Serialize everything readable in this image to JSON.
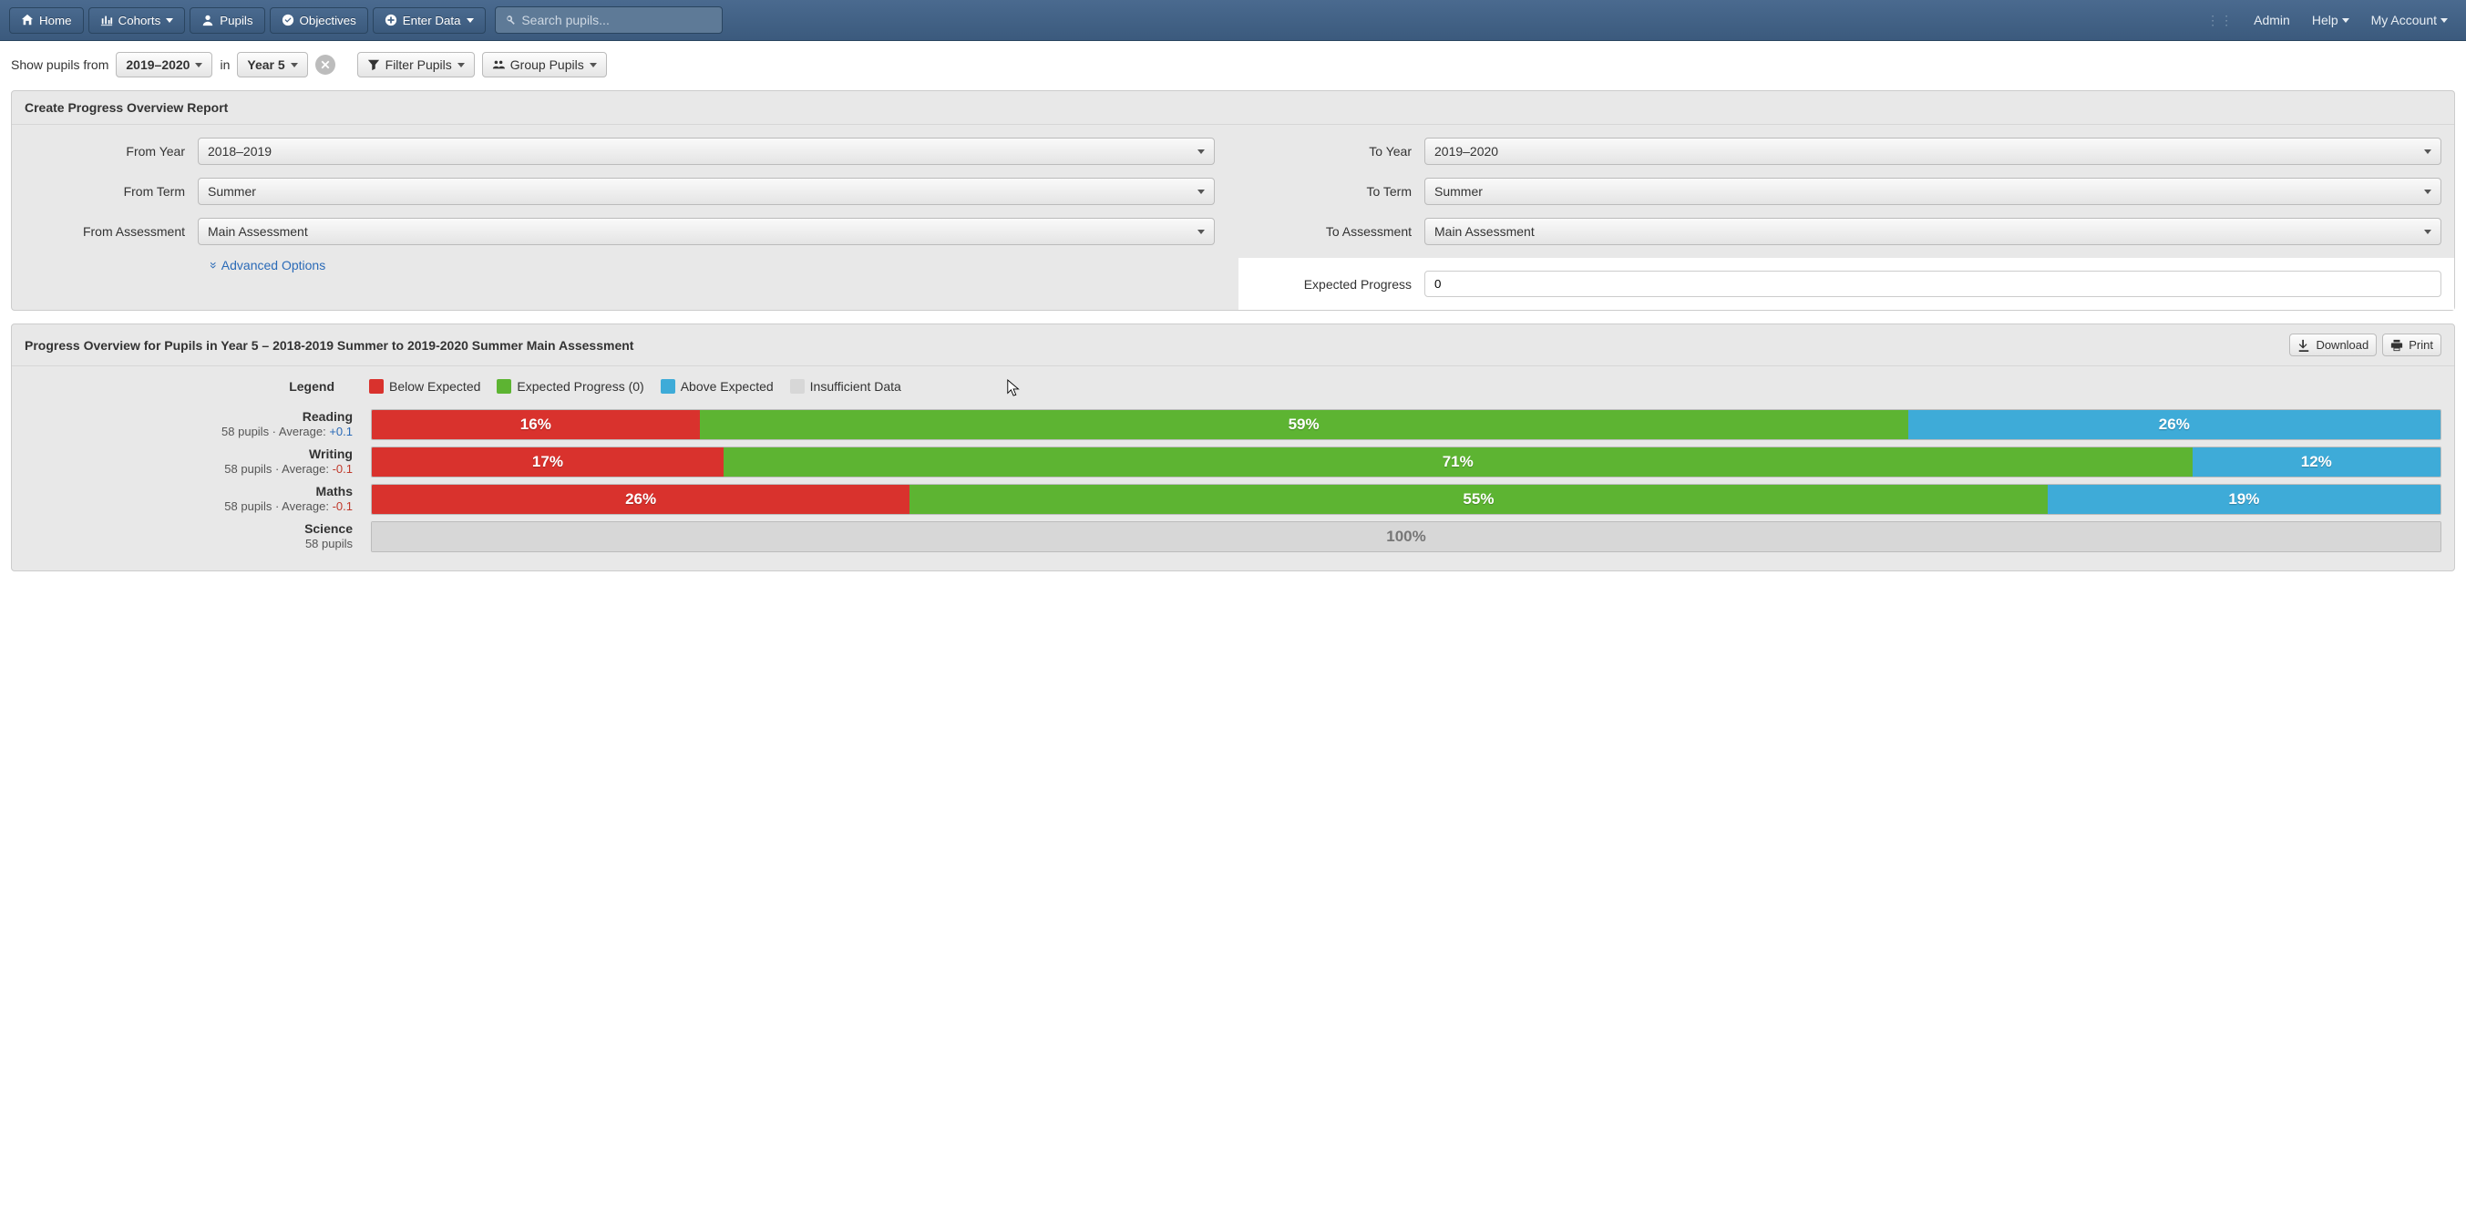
{
  "nav": {
    "home": "Home",
    "cohorts": "Cohorts",
    "pupils": "Pupils",
    "objectives": "Objectives",
    "enter_data": "Enter Data",
    "search_placeholder": "Search pupils...",
    "admin": "Admin",
    "help": "Help",
    "account": "My Account"
  },
  "toolbar": {
    "show_from": "Show pupils from",
    "year_range": "2019–2020",
    "in": "in",
    "year_group": "Year 5",
    "filter": "Filter Pupils",
    "group": "Group Pupils"
  },
  "form": {
    "title": "Create Progress Overview Report",
    "from_year_label": "From Year",
    "from_year": "2018–2019",
    "from_term_label": "From Term",
    "from_term": "Summer",
    "from_assessment_label": "From Assessment",
    "from_assessment": "Main Assessment",
    "advanced": "Advanced Options",
    "to_year_label": "To Year",
    "to_year": "2019–2020",
    "to_term_label": "To Term",
    "to_term": "Summer",
    "to_assessment_label": "To Assessment",
    "to_assessment": "Main Assessment",
    "expected_label": "Expected Progress",
    "expected_value": "0"
  },
  "report": {
    "title": "Progress Overview for Pupils in Year 5 – 2018-2019 Summer to 2019-2020 Summer Main Assessment",
    "download": "Download",
    "print": "Print"
  },
  "legend": {
    "label": "Legend",
    "below": "Below Expected",
    "expected": "Expected Progress (0)",
    "above": "Above Expected",
    "insufficient": "Insufficient Data"
  },
  "colors": {
    "below": "#d9322d",
    "expected": "#5db432",
    "above": "#3eabd8",
    "insufficient": "#d7d7d7"
  },
  "chart_data": {
    "type": "bar",
    "stacked_pct": true,
    "categories": [
      "Below Expected",
      "Expected Progress (0)",
      "Above Expected",
      "Insufficient Data"
    ],
    "series": [
      {
        "name": "Reading",
        "pupils": 58,
        "avg": "+0.1",
        "avg_sign": "pos",
        "values": [
          16,
          59,
          26,
          0
        ]
      },
      {
        "name": "Writing",
        "pupils": 58,
        "avg": "-0.1",
        "avg_sign": "neg",
        "values": [
          17,
          71,
          12,
          0
        ]
      },
      {
        "name": "Maths",
        "pupils": 58,
        "avg": "-0.1",
        "avg_sign": "neg",
        "values": [
          26,
          55,
          19,
          0
        ]
      },
      {
        "name": "Science",
        "pupils": 58,
        "avg": null,
        "avg_sign": null,
        "values": [
          0,
          0,
          0,
          100
        ]
      }
    ]
  },
  "strings": {
    "pupils_word": "pupils",
    "average_word": "Average:"
  }
}
